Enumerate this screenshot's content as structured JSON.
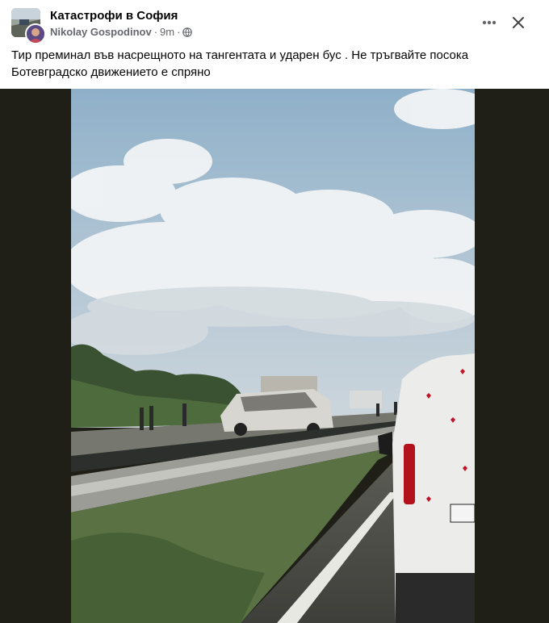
{
  "header": {
    "group_name": "Катастрофи в София",
    "author": "Nikolay Gospodinov",
    "time": "9m",
    "separator": "·"
  },
  "post": {
    "text": "Тир преминал във насрещното на тангентата и ударен бус . Не тръгвайте посока\nБотевградско  движението е спряно"
  },
  "icons": {
    "privacy": "globe-icon",
    "more": "more-options-icon",
    "close": "close-icon"
  },
  "colors": {
    "text": "#050505",
    "secondary_text": "#65676b",
    "media_background": "#1f1f18"
  }
}
